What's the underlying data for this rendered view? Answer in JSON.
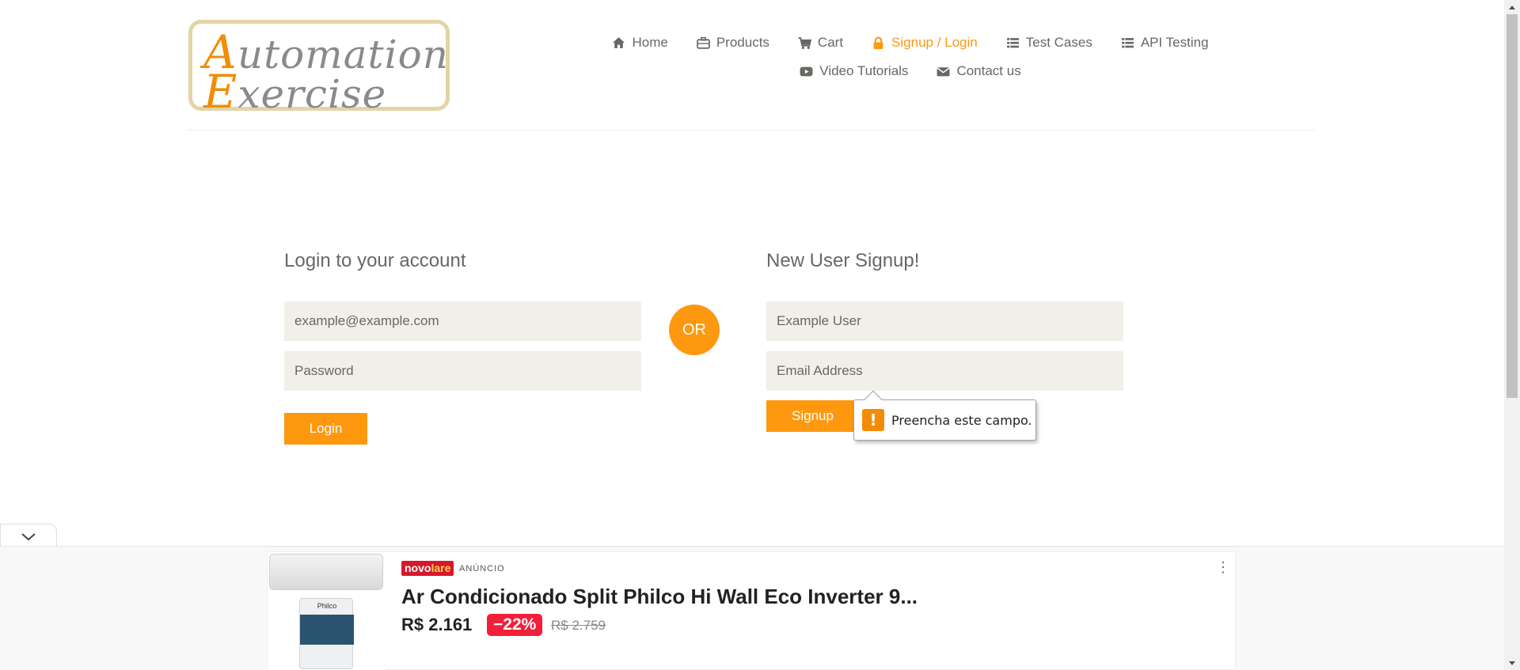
{
  "logo": {
    "line1_cap": "A",
    "line1_rest": "utomation",
    "line2_cap": "E",
    "line2_rest": "xercise"
  },
  "nav": {
    "row1": [
      {
        "label": "Home",
        "icon": "home-icon"
      },
      {
        "label": "Products",
        "icon": "briefcase-icon"
      },
      {
        "label": "Cart",
        "icon": "cart-icon"
      },
      {
        "label": "Signup / Login",
        "icon": "lock-icon",
        "active": true
      },
      {
        "label": "Test Cases",
        "icon": "list-icon"
      },
      {
        "label": "API Testing",
        "icon": "list-icon"
      }
    ],
    "row2": [
      {
        "label": "Video Tutorials",
        "icon": "youtube-play-icon"
      },
      {
        "label": "Contact us",
        "icon": "envelope-icon"
      }
    ]
  },
  "login": {
    "title": "Login to your account",
    "email_value": "example@example.com",
    "password_placeholder": "Password",
    "button": "Login"
  },
  "or_label": "OR",
  "signup": {
    "title": "New User Signup!",
    "name_value": "Example User",
    "email_placeholder": "Email Address",
    "button": "Signup"
  },
  "validation_tooltip": {
    "icon": "warning-icon",
    "text": "Preencha este campo."
  },
  "ad": {
    "brand_a": "novo",
    "brand_b": "lare",
    "label": "ANÚNCIO",
    "title": "Ar Condicionado Split Philco Hi Wall Eco Inverter 9...",
    "price": "R$ 2.161",
    "discount": "−22%",
    "old_price": "R$ 2.759",
    "product_brand": "Philco"
  },
  "colors": {
    "accent": "#fe980f",
    "field_bg": "#f0f0e9",
    "text": "#696763"
  }
}
